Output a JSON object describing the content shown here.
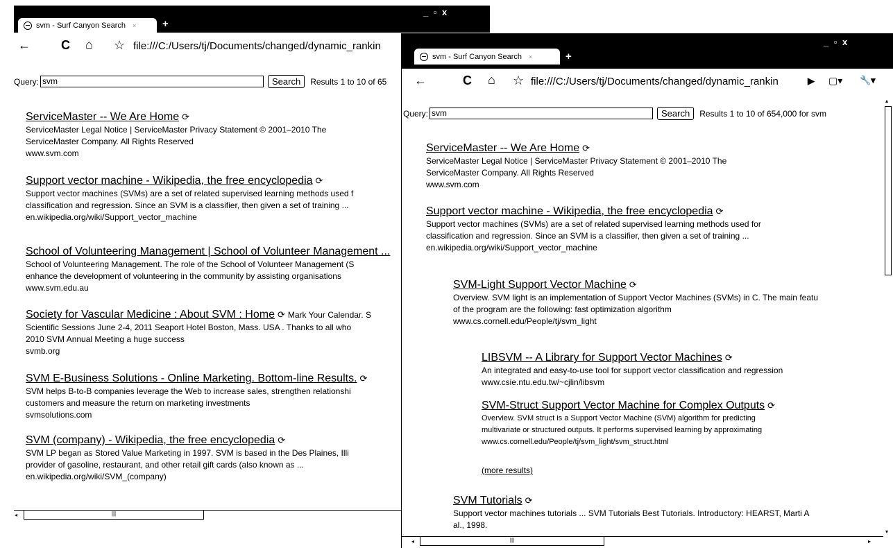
{
  "back_window": {
    "tab_title": "svm - Surf Canyon Search",
    "tab_close": "×",
    "new_tab": "+",
    "window_controls": "_ ▫ x",
    "url": "file:///C:/Users/tj/Documents/changed/dynamic_rankin",
    "query_label": "Query:",
    "query_value": "svm",
    "search_label": "Search",
    "results_count": "Results 1 to 10 of 65",
    "results": [
      {
        "title": "ServiceMaster -- We Are Home",
        "snippet1": "ServiceMaster Legal Notice | ServiceMaster Privacy Statement © 2001–2010 The",
        "snippet2": "ServiceMaster Company. All Rights Reserved",
        "url": "www.svm.com"
      },
      {
        "title": "Support vector machine - Wikipedia, the free encyclopedia",
        "snippet1": "Support vector machines (SVMs) are a set of related supervised learning methods used f",
        "snippet2": "classification and regression. Since an SVM is a classifier, then given a set of training ...",
        "url": "en.wikipedia.org/wiki/Support_vector_machine"
      },
      {
        "title": "School of Volunteering Management | School of Volunteer Management ...",
        "snippet1": "School of Volunteering Management. The role of the School of Volunteer Management (S",
        "snippet2": "enhance the development of volunteering in the community by assisting organisations",
        "url": "www.svm.edu.au"
      },
      {
        "title": "Society for Vascular Medicine : About SVM : Home",
        "title_extra": "Mark Your Calendar. S",
        "snippet1": "Scientific Sessions June 2-4, 2011 Seaport Hotel Boston, Mass. USA . Thanks to all who",
        "snippet2": "2010 SVM Annual Meeting a huge success",
        "url": "svmb.org"
      },
      {
        "title": "SVM E-Business Solutions - Online Marketing. Bottom-line Results.",
        "snippet1": "SVM helps B-to-B companies leverage the Web to increase sales, strengthen relationshi",
        "snippet2": "customers and measure the return on marketing investments",
        "url": "svmsolutions.com"
      },
      {
        "title": "SVM (company) - Wikipedia, the free encyclopedia",
        "snippet1": "SVM LP began as Stored Value Marketing in 1997. SVM is based in the Des Plaines, Illi",
        "snippet2": "provider of gasoline, restaurant, and other retail gift cards (also known as ...",
        "url": "en.wikipedia.org/wiki/SVM_(company)"
      }
    ]
  },
  "front_window": {
    "tab_title": "svm - Surf Canyon Search",
    "tab_close": "×",
    "new_tab": "+",
    "window_controls": "_ ▫ x",
    "url": "file:///C:/Users/tj/Documents/changed/dynamic_rankin",
    "query_label": "Query:",
    "query_value": "svm",
    "search_label": "Search",
    "results_count": "Results 1 to 10 of 654,000 for svm",
    "results": [
      {
        "title": "ServiceMaster -- We Are Home",
        "snippet1": "ServiceMaster Legal Notice | ServiceMaster Privacy Statement © 2001–2010 The",
        "snippet2": "ServiceMaster Company. All Rights Reserved",
        "url": "www.svm.com"
      },
      {
        "title": "Support vector machine - Wikipedia, the free encyclopedia",
        "snippet1": "Support vector machines (SVMs) are a set of related supervised learning methods used for",
        "snippet2": "classification and regression. Since an SVM is a classifier, then given a set of training ...",
        "url": "en.wikipedia.org/wiki/Support_vector_machine"
      },
      {
        "title": "SVM-Light Support Vector Machine",
        "snippet1": "Overview. SVM light is an implementation of Support Vector Machines (SVMs) in C. The main featu",
        "snippet2": "of the program are the following: fast optimization algorithm",
        "url": "www.cs.cornell.edu/People/tj/svm_light"
      },
      {
        "title": "LIBSVM -- A Library for Support Vector Machines",
        "snippet1": "An integrated and easy-to-use tool for support vector classification and regression",
        "url": "www.csie.ntu.edu.tw/~cjlin/libsvm"
      },
      {
        "title": "SVM-Struct Support Vector Machine for Complex Outputs",
        "snippet1": "Overview. SVM struct is a Support Vector Machine (SVM) algorithm for predicting",
        "snippet2": "multivariate or structured outputs. It performs supervised learning by approximating",
        "url": "www.cs.cornell.edu/People/tj/svm_light/svm_struct.html"
      },
      {
        "title": "SVM Tutorials",
        "snippet1": "Support vector machines tutorials ... SVM Tutorials Best Tutorials. Introductory: HEARST, Marti A",
        "snippet2": "al., 1998."
      }
    ],
    "more_results": "(more results)"
  },
  "icons": {
    "back": "←",
    "reload": "C",
    "home": "⌂",
    "star": "☆",
    "play": "▶",
    "page": "▢▾",
    "wrench": "🔧▾",
    "result_arrow": "⟳"
  }
}
